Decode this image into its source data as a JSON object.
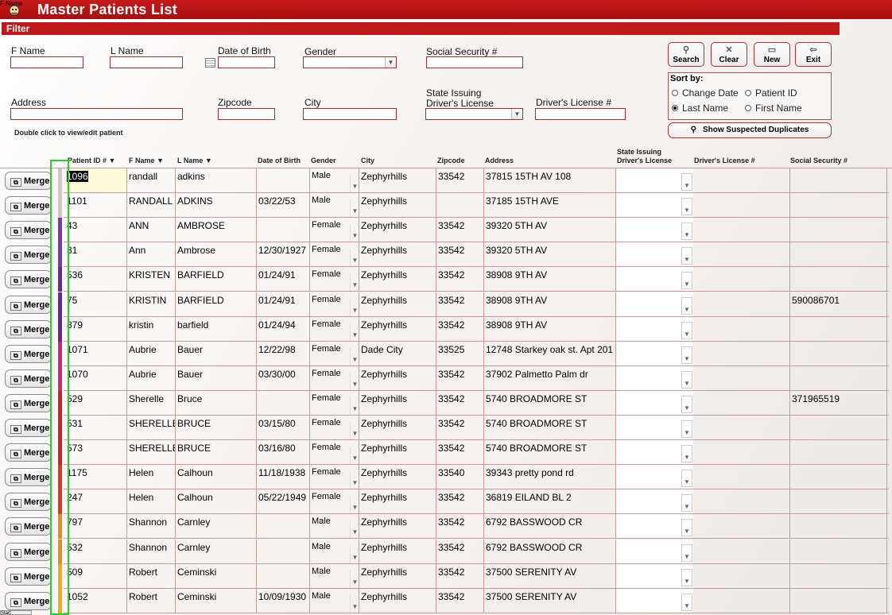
{
  "app": {
    "title": "Master Patients List",
    "logo_text": "F Name"
  },
  "filter": {
    "title": "Filter",
    "labels": {
      "fname": "F Name",
      "lname": "L Name",
      "dob": "Date of Birth",
      "gender": "Gender",
      "ssn": "Social Security #",
      "address": "Address",
      "zipcode": "Zipcode",
      "city": "City",
      "state_line1": "State Issuing",
      "state_line2": "Driver's License",
      "license": "Driver's License #"
    },
    "hint": "Double click to view/edit patient"
  },
  "buttons": {
    "search": "Search",
    "clear": "Clear",
    "new": "New",
    "exit": "Exit"
  },
  "sort": {
    "title": "Sort by:",
    "options": {
      "change_date": "Change Date",
      "patient_id": "Patient ID",
      "last_name": "Last Name",
      "first_name": "First Name"
    },
    "selected": "Last Name"
  },
  "duplicates_button": "Show Suspected Duplicates",
  "table": {
    "headers": {
      "patient_id": "Patient ID #",
      "fname": "F Name",
      "lname": "L Name",
      "dob": "Date of Birth",
      "gender": "Gender",
      "city": "City",
      "zipcode": "Zipcode",
      "address": "Address",
      "state_line1": "State Issuing",
      "state_line2": "Driver's License",
      "license": "Driver's License #",
      "ssn": "Social Security #"
    },
    "merge_label": "Merge",
    "rows": [
      {
        "id": "1096",
        "fname": "randall",
        "lname": "adkins",
        "dob": "",
        "gender": "Male",
        "city": "Zephyrhills",
        "zip": "33542",
        "address": "37815 15TH AV 108",
        "ssn": "",
        "color": "#d6c2c2"
      },
      {
        "id": "1101",
        "fname": "RANDALL",
        "lname": "ADKINS",
        "dob": "03/22/53",
        "gender": "Male",
        "city": "Zephyrhills",
        "zip": "",
        "address": "37185 15TH AVE",
        "ssn": "",
        "color": "#d6c2c2"
      },
      {
        "id": "43",
        "fname": "ANN",
        "lname": "AMBROSE",
        "dob": "",
        "gender": "Female",
        "city": "Zephyrhills",
        "zip": "33542",
        "address": "39320 5TH AV",
        "ssn": "",
        "color": "#7a3a9a"
      },
      {
        "id": "31",
        "fname": "Ann",
        "lname": "Ambrose",
        "dob": "12/30/1927",
        "gender": "Female",
        "city": "Zephyrhills",
        "zip": "33542",
        "address": "39320 5TH AV",
        "ssn": "",
        "color": "#7a3a9a"
      },
      {
        "id": "536",
        "fname": "KRISTEN",
        "lname": "BARFIELD",
        "dob": "01/24/91",
        "gender": "Female",
        "city": "Zephyrhills",
        "zip": "33542",
        "address": "38908 9TH AV",
        "ssn": "",
        "color": "#6a2a8a"
      },
      {
        "id": "75",
        "fname": "KRISTIN",
        "lname": "BARFIELD",
        "dob": "01/24/91",
        "gender": "Female",
        "city": "Zephyrhills",
        "zip": "33542",
        "address": "38908 9TH AV",
        "ssn": "590086701",
        "color": "#6a2a8a"
      },
      {
        "id": "879",
        "fname": "kristin",
        "lname": "barfield",
        "dob": "01/24/94",
        "gender": "Female",
        "city": "Zephyrhills",
        "zip": "33542",
        "address": "38908 9TH AV",
        "ssn": "",
        "color": "#6a2a8a"
      },
      {
        "id": "1071",
        "fname": "Aubrie",
        "lname": "Bauer",
        "dob": "12/22/98",
        "gender": "Female",
        "city": "Dade City",
        "zip": "33525",
        "address": "12748 Starkey oak st. Apt 201",
        "ssn": "",
        "color": "#c03070"
      },
      {
        "id": "1070",
        "fname": "Aubrie",
        "lname": "Bauer",
        "dob": "03/30/00",
        "gender": "Female",
        "city": "Zephyrhills",
        "zip": "33542",
        "address": "37902 Palmetto Palm dr",
        "ssn": "",
        "color": "#c03070"
      },
      {
        "id": "529",
        "fname": "Sherelle",
        "lname": "Bruce",
        "dob": "",
        "gender": "Female",
        "city": "Zephyrhills",
        "zip": "33542",
        "address": "5740 BROADMORE ST",
        "ssn": "371965519",
        "color": "#c02828"
      },
      {
        "id": "531",
        "fname": "SHERELLE",
        "lname": "BRUCE",
        "dob": "03/15/80",
        "gender": "Female",
        "city": "Zephyrhills",
        "zip": "33542",
        "address": "5740 BROADMORE ST",
        "ssn": "",
        "color": "#c02828"
      },
      {
        "id": "573",
        "fname": "SHERELLE",
        "lname": "BRUCE",
        "dob": "03/16/80",
        "gender": "Female",
        "city": "Zephyrhills",
        "zip": "33542",
        "address": "5740 BROADMORE ST",
        "ssn": "",
        "color": "#c02828"
      },
      {
        "id": "1175",
        "fname": "Helen",
        "lname": "Calhoun",
        "dob": "11/18/1938",
        "gender": "Female",
        "city": "Zephyrhills",
        "zip": "33540",
        "address": "39343 pretty pond rd",
        "ssn": "",
        "color": "#d04020"
      },
      {
        "id": "247",
        "fname": "Helen",
        "lname": "Calhoun",
        "dob": "05/22/1949",
        "gender": "Female",
        "city": "Zephyrhills",
        "zip": "33542",
        "address": "36819 EILAND BL 2",
        "ssn": "",
        "color": "#d04020"
      },
      {
        "id": "797",
        "fname": "Shannon",
        "lname": "Carnley",
        "dob": "",
        "gender": "Male",
        "city": "Zephyrhills",
        "zip": "33542",
        "address": "6792 BASSWOOD CR",
        "ssn": "",
        "color": "#e09020"
      },
      {
        "id": "532",
        "fname": "Shannon",
        "lname": "Carnley",
        "dob": "",
        "gender": "Male",
        "city": "Zephyrhills",
        "zip": "33542",
        "address": "6792 BASSWOOD CR",
        "ssn": "",
        "color": "#e09020"
      },
      {
        "id": "509",
        "fname": "Robert",
        "lname": "Ceminski",
        "dob": "",
        "gender": "Male",
        "city": "Zephyrhills",
        "zip": "33542",
        "address": "37500 SERENITY AV",
        "ssn": "",
        "color": "#e8b020"
      },
      {
        "id": "1052",
        "fname": "Robert",
        "lname": "Ceminski",
        "dob": "10/09/1930",
        "gender": "Male",
        "city": "Zephyrhills",
        "zip": "33542",
        "address": "37500 SERENITY AV",
        "ssn": "",
        "color": "#e8b020"
      }
    ]
  },
  "taskbar": {
    "label": "Start"
  }
}
